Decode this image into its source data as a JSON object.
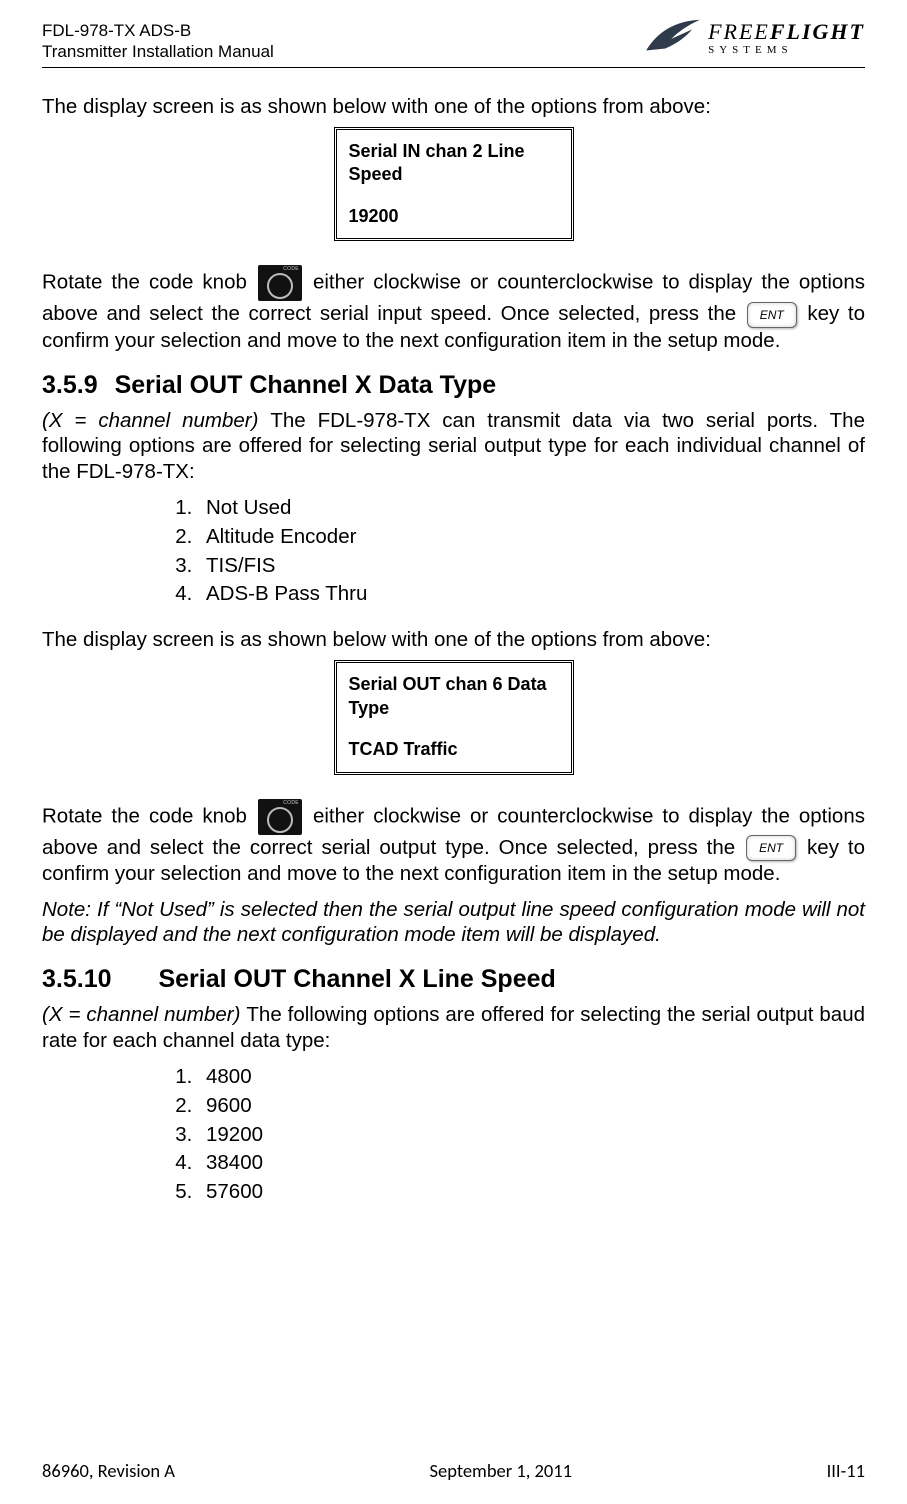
{
  "header": {
    "doc_line1": "FDL-978-TX ADS-B",
    "doc_line2": "Transmitter Installation Manual",
    "logo_brand_1": "FREE",
    "logo_brand_2": "FLIGHT",
    "logo_sub": "SYSTEMS"
  },
  "intro1": "The display screen is as shown below with one of the options from above:",
  "box1": {
    "title": "Serial IN chan 2 Line Speed",
    "value": "19200"
  },
  "para_knob_in_a": "Rotate the code knob ",
  "para_knob_in_b": " either clockwise or counterclockwise to display the options above and select the correct serial input speed. Once selected, press the  ",
  "para_knob_in_c": " key to confirm your selection and move to the next configuration item in the setup mode.",
  "sec359": {
    "num": "3.5.9",
    "title": "Serial OUT Channel X Data Type",
    "lead_i": "(X = channel number) ",
    "lead": "The FDL-978-TX can transmit data via two serial ports. The following options are offered for selecting serial output type for each individual channel of the FDL-978-TX:",
    "options": [
      "Not Used",
      "Altitude Encoder",
      "TIS/FIS",
      "ADS-B Pass Thru"
    ]
  },
  "intro2": "The display screen is as shown below with one of the options from above:",
  "box2": {
    "title": "Serial OUT chan 6 Data Type",
    "value": "TCAD Traffic"
  },
  "para_knob_out_a": "Rotate the code knob ",
  "para_knob_out_b": " either clockwise or counterclockwise to display the options above and select the correct serial output type. Once selected, press the  ",
  "para_knob_out_c": " key to confirm your selection and move to the next configuration item in the setup mode.",
  "note": "Note: If “Not Used” is selected then the serial output line speed configuration mode will not be displayed and the next configuration mode item will be displayed.",
  "sec3510": {
    "num": "3.5.10",
    "title": "Serial OUT Channel X Line Speed",
    "lead_i": "(X = channel number) ",
    "lead": "The following options are offered for selecting the serial output baud rate for each channel data type:",
    "options": [
      "4800",
      "9600",
      "19200",
      "38400",
      "57600"
    ]
  },
  "footer": {
    "left": "86960, Revision A",
    "center": "September 1, 2011",
    "right": "III-11"
  },
  "icons": {
    "code_knob": "code-knob-icon",
    "ent_key": "ENT"
  }
}
